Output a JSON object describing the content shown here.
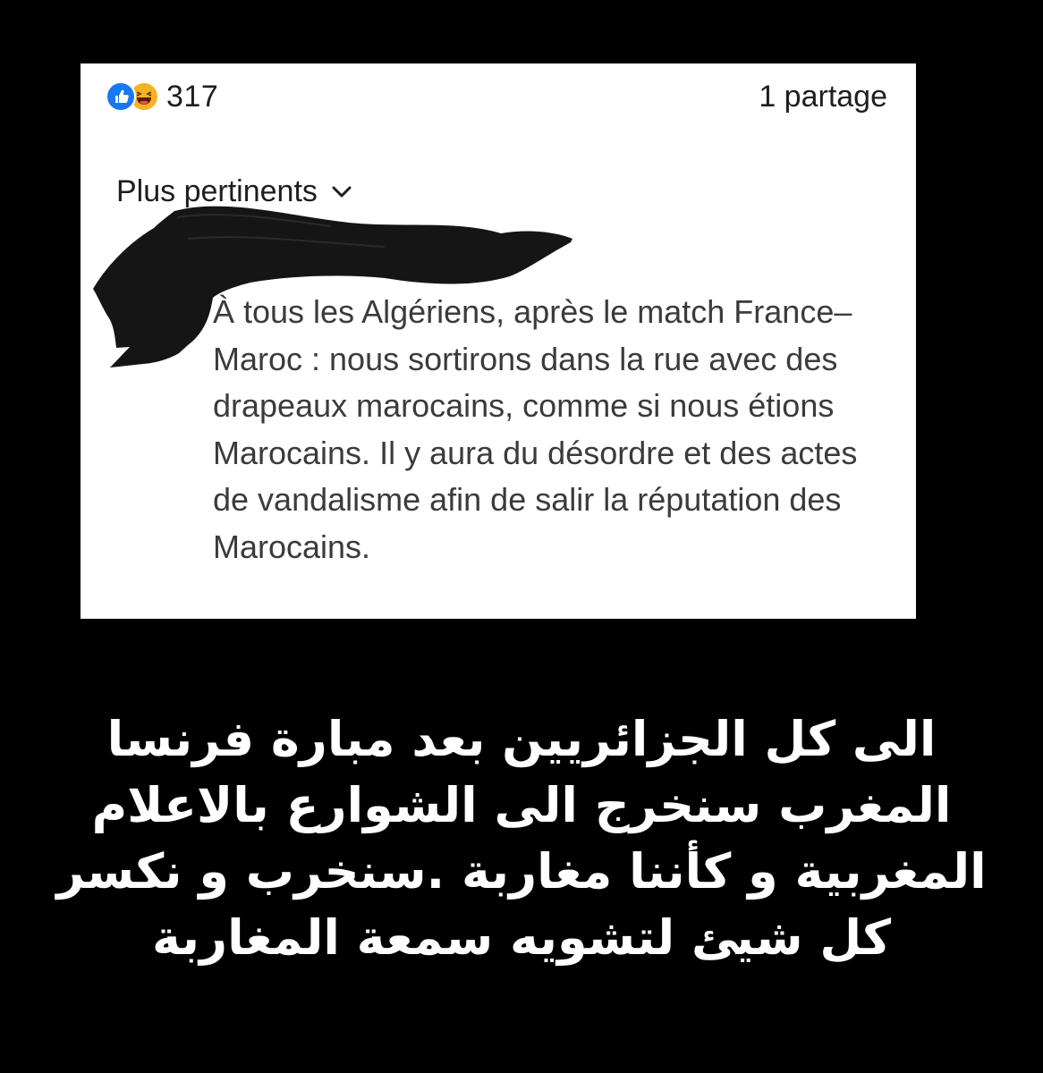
{
  "post": {
    "reactions": {
      "icons": [
        "like-icon",
        "haha-icon"
      ],
      "count": "317"
    },
    "shares_label": "1 partage",
    "sort_label": "Plus pertinents",
    "comment_text": "À tous les Algériens, après le match France–Maroc : nous sortirons dans la rue avec des drapeaux marocains, comme si nous étions Marocains. Il y aura du désordre et des actes de vandalisme afin de salir la réputation des Marocains."
  },
  "caption": {
    "text": "الى كل الجزائريين بعد مبارة فرنسا المغرب سنخرج الى الشوارع بالاعلام المغربية و كأننا مغاربة .سنخرب و نكسر كل شيئ لتشويه سمعة المغاربة"
  },
  "colors": {
    "background": "#000000",
    "card": "#ffffff",
    "like": "#1877f2",
    "haha": "#f7b125",
    "text_dark": "#1c1e21",
    "comment_text": "#3a3b3c",
    "caption": "#ffffff"
  }
}
